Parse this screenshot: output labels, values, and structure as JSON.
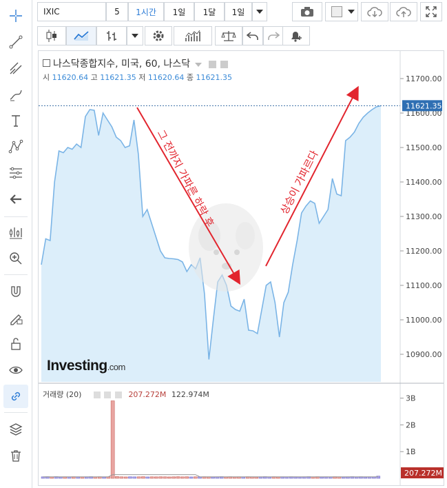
{
  "toolbar": {
    "symbol": "IXIC",
    "interval_num": "5",
    "interval_active": "1시간",
    "range_1": "1일",
    "range_2": "1달",
    "range_3": "1일"
  },
  "chart": {
    "title": "나스닥종합지수, 미국, 60, 나스닥",
    "ohlc": {
      "o_label": "시",
      "o_value": "11620.64",
      "h_label": "고",
      "h_value": "11621.35",
      "l_label": "저",
      "l_value": "11620.64",
      "c_label": "종",
      "c_value": "11621.35"
    },
    "price_ticks": [
      "11700.00",
      "11600.00",
      "11500.00",
      "11400.00",
      "11300.00",
      "11200.00",
      "11100.00",
      "11000.00",
      "10900.00"
    ],
    "current_price": "11621.35",
    "annotation_left": "그 전까지 가파른 하락 후",
    "annotation_right": "상승이 가파르다",
    "watermark": "Investing",
    "watermark_suffix": ".com",
    "line_color": "#7ab4e6",
    "area_color": "#dceefa",
    "arrow_color": "#e2252e"
  },
  "volume": {
    "label": "거래량 (20)",
    "value1": "207.272M",
    "value2": "122.974M",
    "ticks": [
      "3B",
      "2B",
      "1B"
    ],
    "current": "207.272M"
  },
  "chart_data": {
    "type": "area",
    "series": [
      {
        "values": [
          11160,
          11235,
          11230,
          11400,
          11490,
          11485,
          11500,
          11495,
          11510,
          11500,
          11590,
          11610,
          11608,
          11535,
          11600,
          11580,
          11560,
          11530,
          11520,
          11500,
          11505,
          11580,
          11480,
          11300,
          11320,
          11280,
          11240,
          11200,
          11180,
          11178,
          11177,
          11175,
          11168,
          11140,
          11160,
          11148,
          11180,
          11075,
          10885,
          11000,
          11110,
          11130,
          11100,
          11040,
          11030,
          11025,
          11060,
          10970,
          10968,
          10960,
          11030,
          11100,
          11110,
          11050,
          10950,
          11050,
          11080,
          11160,
          11230,
          11310,
          11330,
          11345,
          11338,
          11280,
          11300,
          11320,
          11410,
          11365,
          11360,
          11520,
          11530,
          11545,
          11570,
          11588,
          11600,
          11610,
          11618,
          11621
        ]
      }
    ],
    "ylim": [
      10820,
      11760
    ],
    "volume": [
      60,
      62,
      58,
      65,
      55,
      60,
      58,
      62,
      60,
      55,
      60,
      65,
      58,
      62,
      55,
      60,
      2900,
      70,
      60,
      55,
      62,
      58,
      60,
      65,
      55,
      60,
      58,
      62,
      60,
      55,
      60,
      65,
      58,
      62,
      55,
      60,
      58,
      62,
      60,
      55,
      60,
      65,
      58,
      62,
      55,
      60,
      58,
      62,
      60,
      55,
      60,
      65,
      58,
      62,
      55,
      60,
      58,
      62,
      60,
      55,
      60,
      65,
      58,
      62,
      55,
      60,
      58,
      62,
      60,
      55,
      60,
      65,
      58,
      62,
      55,
      60,
      58,
      85
    ],
    "volume_ylim": [
      0,
      3300
    ]
  }
}
